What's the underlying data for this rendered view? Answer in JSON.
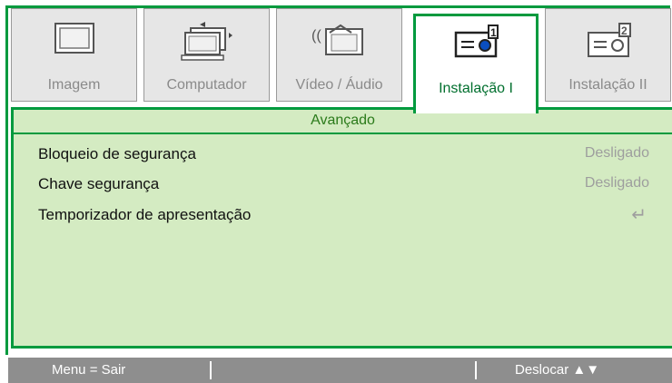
{
  "tabs": [
    {
      "label": "Imagem",
      "icon": "monitor-icon"
    },
    {
      "label": "Computador",
      "icon": "computer-icon"
    },
    {
      "label": "Vídeo / Áudio",
      "icon": "video-audio-icon"
    },
    {
      "label": "Instalação I",
      "icon": "projector-icon",
      "active": true
    },
    {
      "label": "Instalação II",
      "icon": "projector-2-icon"
    }
  ],
  "section": {
    "title": "Avançado"
  },
  "settings": [
    {
      "name": "Bloqueio de segurança",
      "value": "Desligado"
    },
    {
      "name": "Chave segurança",
      "value": "Desligado"
    },
    {
      "name": "Temporizador de apresentação",
      "value": "↵",
      "icon": "enter-icon"
    }
  ],
  "statusbar": {
    "menu": "Menu = Sair",
    "navigate": "Deslocar ▲▼"
  },
  "colors": {
    "accent": "#009a3e",
    "panel": "#d4ebc2",
    "statusbar": "#8e8e8e"
  }
}
